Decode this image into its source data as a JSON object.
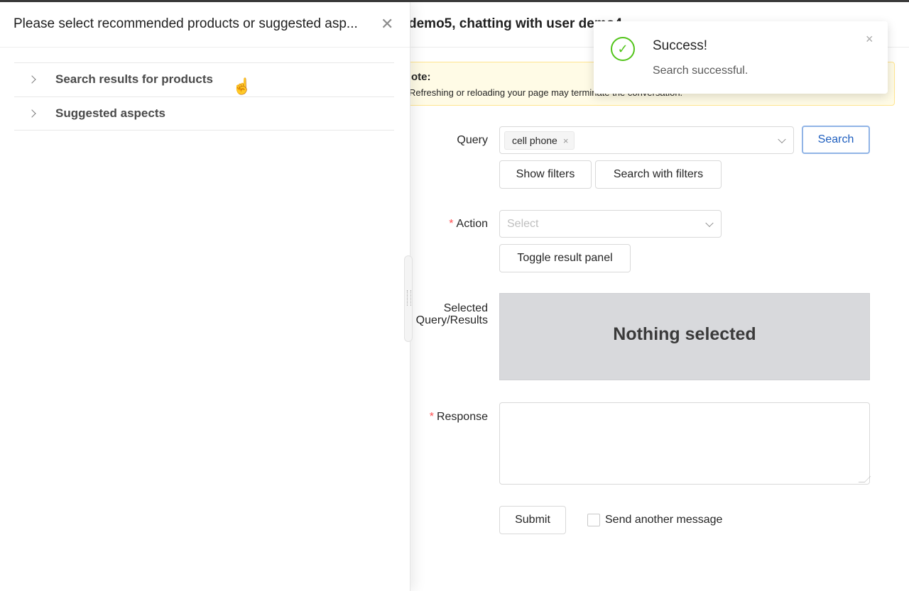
{
  "drawer": {
    "title": "Please select recommended products or suggested asp...",
    "close_glyph": "✕",
    "items": [
      {
        "label": "Search results for products"
      },
      {
        "label": "Suggested aspects"
      }
    ]
  },
  "main": {
    "title": "demo5, chatting with user demo4",
    "notice": {
      "title": "ote:",
      "text": "Refreshing or reloading your page may terminate the conversation."
    },
    "query": {
      "label": "Query",
      "tag": "cell phone",
      "tag_close": "×",
      "search_button": "Search",
      "show_filters": "Show filters",
      "search_with_filters": "Search with filters"
    },
    "action": {
      "required_mark": "*",
      "label": "Action",
      "placeholder": "Select",
      "toggle_button": "Toggle result panel"
    },
    "selected": {
      "label_line1": "Selected",
      "label_line2": "Query/Results",
      "empty_text": "Nothing selected"
    },
    "response": {
      "required_mark": "*",
      "label": "Response",
      "value": ""
    },
    "submit": "Submit",
    "send_another": "Send another message"
  },
  "toast": {
    "title": "Success!",
    "message": "Search successful.",
    "icon_glyph": "✓",
    "close_glyph": "×"
  },
  "colors": {
    "accent": "#1f5fbf",
    "success": "#52c41a",
    "required": "#ff4d4f",
    "notice_bg": "#fffbe6",
    "selection_bg": "#d8d9dc"
  },
  "icons": [
    "close-icon",
    "chevron-right-icon",
    "chevron-down-icon",
    "check-circle-icon",
    "hand-cursor-icon",
    "drag-handle-icon"
  ]
}
